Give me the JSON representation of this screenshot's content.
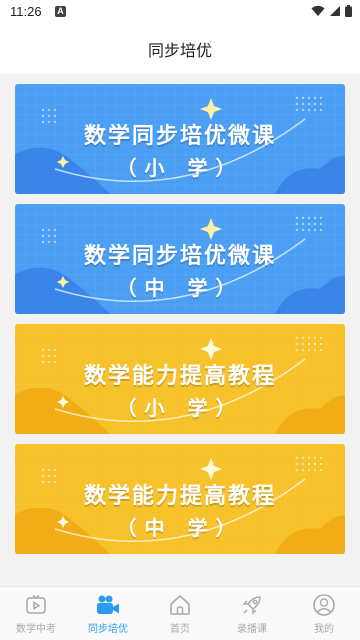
{
  "status_bar": {
    "time": "11:26",
    "notification_glyph": "A"
  },
  "header": {
    "title": "同步培优"
  },
  "banners": [
    {
      "title": "数学同步培优微课",
      "subtitle": "（小 学）",
      "theme": "blue"
    },
    {
      "title": "数学同步培优微课",
      "subtitle": "（中 学）",
      "theme": "blue"
    },
    {
      "title": "数学能力提高教程",
      "subtitle": "（小 学）",
      "theme": "yellow"
    },
    {
      "title": "数学能力提高教程",
      "subtitle": "（中 学）",
      "theme": "yellow"
    }
  ],
  "colors": {
    "blue_bg": "#4a9ef3",
    "blue_dark": "#3a86e8",
    "yellow_bg": "#f7c12a",
    "yellow_dark": "#f2ac16",
    "accent": "#2d9cf0",
    "inactive": "#aaaaaa"
  },
  "tabbar": {
    "items": [
      {
        "label": "数学中考",
        "icon": "play-icon",
        "active": false
      },
      {
        "label": "同步培优",
        "icon": "video-camera-icon",
        "active": true
      },
      {
        "label": "首页",
        "icon": "home-icon",
        "active": false
      },
      {
        "label": "录播课",
        "icon": "rocket-icon",
        "active": false
      },
      {
        "label": "我的",
        "icon": "user-icon",
        "active": false
      }
    ]
  }
}
